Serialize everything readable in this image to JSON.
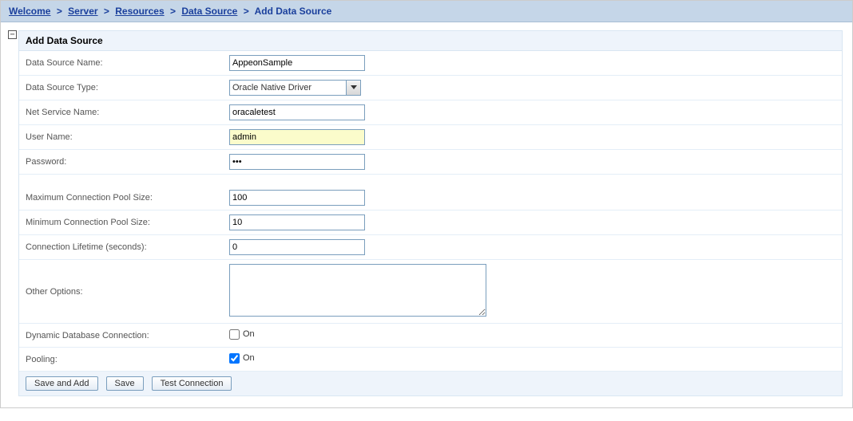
{
  "breadcrumb": {
    "welcome": "Welcome",
    "server": "Server",
    "resources": "Resources",
    "data_source": "Data Source",
    "current": "Add Data Source",
    "sep": ">"
  },
  "panel": {
    "title": "Add Data Source",
    "collapse_glyph": "−"
  },
  "fields": {
    "data_source_name": {
      "label": "Data Source Name:",
      "value": "AppeonSample"
    },
    "data_source_type": {
      "label": "Data Source Type:",
      "value": "Oracle Native Driver"
    },
    "net_service_name": {
      "label": "Net Service Name:",
      "value": "oracaletest"
    },
    "user_name": {
      "label": "User Name:",
      "value": "admin"
    },
    "password": {
      "label": "Password:",
      "value": "•••"
    },
    "max_pool": {
      "label": "Maximum Connection Pool Size:",
      "value": "100"
    },
    "min_pool": {
      "label": "Minimum Connection Pool Size:",
      "value": "10"
    },
    "conn_lifetime": {
      "label": "Connection Lifetime (seconds):",
      "value": "0"
    },
    "other_options": {
      "label": "Other Options:",
      "value": ""
    },
    "dynamic_db": {
      "label": "Dynamic Database Connection:",
      "on_label": "On",
      "checked": false
    },
    "pooling": {
      "label": "Pooling:",
      "on_label": "On",
      "checked": true
    }
  },
  "actions": {
    "save_and_add": "Save and Add",
    "save": "Save",
    "test_connection": "Test Connection"
  }
}
